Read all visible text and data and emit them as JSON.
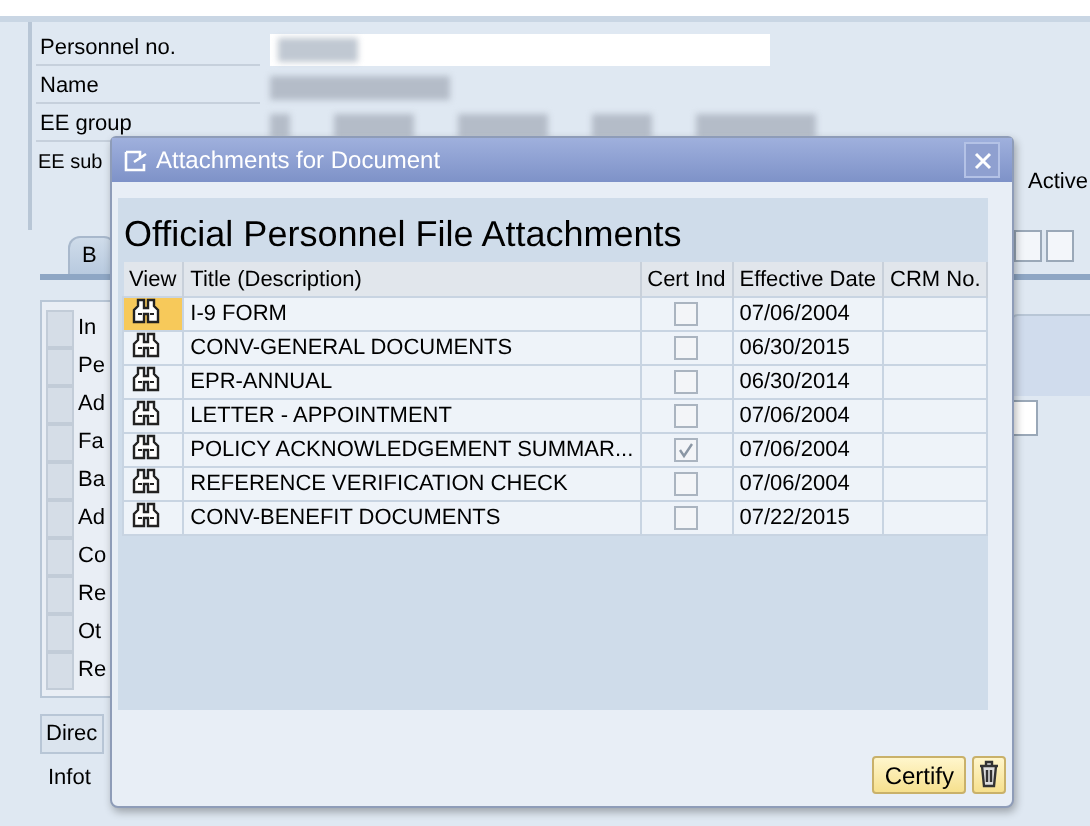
{
  "background": {
    "fields": [
      {
        "label": "Personnel no."
      },
      {
        "label": "Name"
      },
      {
        "label": "EE group"
      },
      {
        "label": "EE sub"
      }
    ],
    "status": "Active",
    "tab": "B",
    "side_items": [
      "In",
      "Pe",
      "Ad",
      "Fa",
      "Ba",
      "Ad",
      "Co",
      "Re",
      "Ot",
      "Re"
    ],
    "section": "Direc",
    "section_label": "Infot"
  },
  "dialog": {
    "title": "Attachments for Document",
    "heading": "Official Personnel File Attachments",
    "columns": [
      "View",
      "Title (Description)",
      "Cert Ind",
      "Effective Date",
      "CRM No."
    ],
    "rows": [
      {
        "title": "I-9 FORM",
        "cert": false,
        "date": "07/06/2004",
        "selected": true
      },
      {
        "title": "CONV-GENERAL DOCUMENTS",
        "cert": false,
        "date": "06/30/2015",
        "selected": false
      },
      {
        "title": "EPR-ANNUAL",
        "cert": false,
        "date": "06/30/2014",
        "selected": false
      },
      {
        "title": "LETTER - APPOINTMENT",
        "cert": false,
        "date": "07/06/2004",
        "selected": false
      },
      {
        "title": "POLICY ACKNOWLEDGEMENT SUMMAR...",
        "cert": true,
        "date": "07/06/2004",
        "selected": false
      },
      {
        "title": "REFERENCE VERIFICATION CHECK",
        "cert": false,
        "date": "07/06/2004",
        "selected": false
      },
      {
        "title": "CONV-BENEFIT DOCUMENTS",
        "cert": false,
        "date": "07/22/2015",
        "selected": false
      }
    ],
    "certify": "Certify"
  }
}
